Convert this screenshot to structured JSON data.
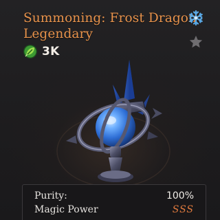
{
  "item": {
    "title_line1": "Summoning: Frost Dragon",
    "title_line2": "Legendary",
    "value": "3K",
    "value_icon": "green-leaf-coin-icon",
    "element_icon": "snowflake-icon",
    "favorite_icon": "star-icon",
    "image": "frost-orb-scepter-image"
  },
  "stats": {
    "rows": [
      {
        "label": "Purity:",
        "value": "100%"
      },
      {
        "label": "Magic Power",
        "value": "SSS"
      }
    ]
  },
  "colors": {
    "title": "#e8934c",
    "grade": "#e07a3e",
    "snowflake": "#5aa9e6",
    "star": "#6f6d70",
    "orb": "#2f6fd6"
  }
}
